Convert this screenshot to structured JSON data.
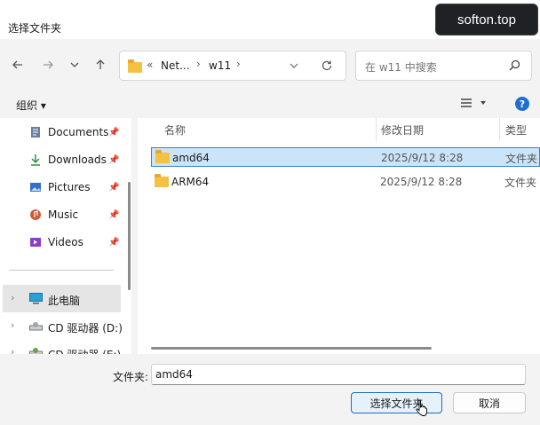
{
  "window": {
    "title": "选择文件夹"
  },
  "watermark": "softon.top",
  "nav": {
    "path": [
      "Net...",
      "w11"
    ],
    "path_prefix": "«",
    "search_placeholder": "在 w11 中搜索"
  },
  "toolbar": {
    "organize_label": "组织 ▾"
  },
  "sidebar": {
    "items": [
      {
        "label": "Documents",
        "icon": "documents-icon",
        "color": "#6b7fa3",
        "pinned": true
      },
      {
        "label": "Downloads",
        "icon": "download-icon",
        "color": "#2f8f46",
        "pinned": true
      },
      {
        "label": "Pictures",
        "icon": "pictures-icon",
        "color": "#2f6fd0",
        "pinned": true
      },
      {
        "label": "Music",
        "icon": "music-icon",
        "color": "#d05a3a",
        "pinned": true
      },
      {
        "label": "Videos",
        "icon": "videos-icon",
        "color": "#8a3fc9",
        "pinned": true
      }
    ],
    "tree": [
      {
        "label": "此电脑",
        "icon": "computer-icon",
        "selected": true
      },
      {
        "label": "CD 驱动器 (D:)",
        "icon": "cd-drive-icon",
        "selected": false
      },
      {
        "label": "CD 驱动器 (E:)",
        "icon": "cd-drive-icon",
        "selected": false
      }
    ]
  },
  "columns": {
    "name": "名称",
    "date": "修改日期",
    "type": "类型"
  },
  "files": [
    {
      "name": "amd64",
      "date": "2025/9/12 8:28",
      "type": "文件夹",
      "selected": true
    },
    {
      "name": "ARM64",
      "date": "2025/9/12 8:28",
      "type": "文件夹",
      "selected": false
    }
  ],
  "footer": {
    "folder_label": "文件夹:",
    "folder_value": "amd64",
    "select_button": "选择文件夹",
    "cancel_button": "取消"
  }
}
